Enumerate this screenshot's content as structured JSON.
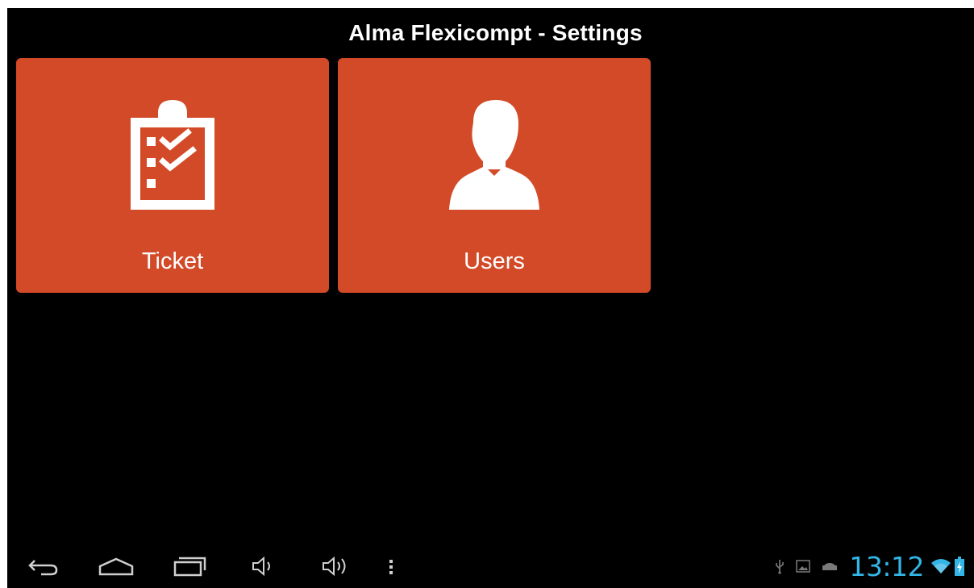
{
  "app": {
    "title": "Alma Flexicompt - Settings"
  },
  "tiles": [
    {
      "label": "Ticket",
      "icon": "clipboard-checklist-icon"
    },
    {
      "label": "Users",
      "icon": "user-silhouette-icon"
    }
  ],
  "navbar": {
    "buttons": [
      "back-icon",
      "home-icon",
      "recent-apps-icon",
      "volume-down-icon",
      "volume-up-icon",
      "menu-icon"
    ]
  },
  "status_bar": {
    "time": "13:12",
    "icons": [
      "usb-icon",
      "gallery-notification-icon",
      "android-debug-icon",
      "wifi-icon",
      "battery-charging-icon"
    ]
  },
  "colors": {
    "tile": "#d24a27",
    "background": "#000000",
    "clock": "#33b5e5",
    "tile_text": "#ffffff"
  }
}
